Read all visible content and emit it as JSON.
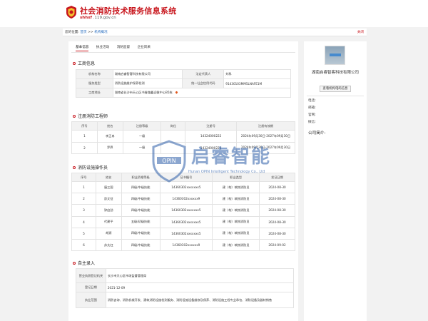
{
  "header": {
    "site_title": "社会消防技术服务信息系统",
    "site_url_prefix": "shhxf",
    "site_url_suffix": ".119.gov.cn"
  },
  "breadcrumb": {
    "label": "您的位置:",
    "home": "首页",
    "sep": ">>",
    "current": "机构概况",
    "close": "关闭"
  },
  "tabs": [
    "基本信息",
    "执业活动",
    "消防监督",
    "企业风采"
  ],
  "business_info": {
    "heading": "工商信息",
    "rows": [
      {
        "l1": "机构名称",
        "v1": "湖南启睿智客科技有限公司",
        "l2": "法定代表人",
        "v2": "刘科"
      },
      {
        "l1": "服务类型",
        "v1": "消防设施维护保养检测",
        "l2": "统一社会信用代码",
        "v2": "91430103MM5LNAFE1M"
      }
    ],
    "address_label": "工商地址",
    "address_value": "湖南省长沙市天心区书香路鑫远微中心B5栋"
  },
  "engineers": {
    "heading": "注册消防工程师",
    "columns": [
      "序号",
      "姓名",
      "注册等级",
      "岗位",
      "注册号",
      "注册有效期"
    ],
    "rows": [
      [
        "1",
        "李正冉",
        "一级",
        "",
        "14324000222",
        "2024年09月30日-2027年09月30日"
      ],
      [
        "2",
        "罗界",
        "一级",
        "",
        "14324000223",
        "2024年09月30日-2027年09月30日"
      ]
    ]
  },
  "operators": {
    "heading": "消防设施操作员",
    "columns": [
      "序号",
      "姓名",
      "职业资格等级",
      "证书编号",
      "职业类型",
      "发证日期"
    ],
    "rows": [
      [
        "1",
        "唐三国",
        "四级/中级技能",
        "14360302xxxxxxx5",
        "建（构）筑物消防员",
        "2024-08-30"
      ],
      [
        "2",
        "彭文征",
        "四级/中级技能",
        "14360302xxxxxx9",
        "建（构）筑物消防员",
        "2024-08-30"
      ],
      [
        "3",
        "钟启劲",
        "四级/中级技能",
        "14360302xxxxxxx5",
        "建（构）筑物消防员",
        "2024-08-30"
      ],
      [
        "4",
        "代建平",
        "五级/初级技能",
        "14360302xxxxxxx5",
        "建（构）筑物消防员",
        "2024-08-30"
      ],
      [
        "5",
        "胡源",
        "四级/中级技能",
        "14360302xxxxxxx5",
        "建（构）筑物消防员",
        "2024-08-30"
      ],
      [
        "6",
        "苏太红",
        "四级/中级技能",
        "14360302xxxxxx9",
        "建（构）筑物消防员",
        "2024-09-02"
      ]
    ]
  },
  "self_entry": {
    "heading": "自主录入",
    "rows": [
      {
        "label": "营业执照登记机关",
        "value": "长沙市天心区市场监督管理局"
      },
      {
        "label": "登记日期",
        "value": "2021-12-09"
      },
      {
        "label": "执业范围",
        "value": "消防咨询、消防机械开发、建筑消防设施检测服务、消防设施设备维修及保养、消防设施工程专业承包、消防设备及器材销售"
      }
    ]
  },
  "sidebar": {
    "company_name": "湖南启睿智客科技有限公司",
    "view_button": "查看机构电码信息",
    "contacts": [
      "电话:",
      "邮箱:",
      "官网:",
      "微信:"
    ],
    "profile_heading": "公司简介:"
  },
  "watermark": {
    "logo_text": "OPIN",
    "brand": "启睿智能",
    "sub": "Hunan OPIN Intelligent Technology Co., Ltd"
  }
}
